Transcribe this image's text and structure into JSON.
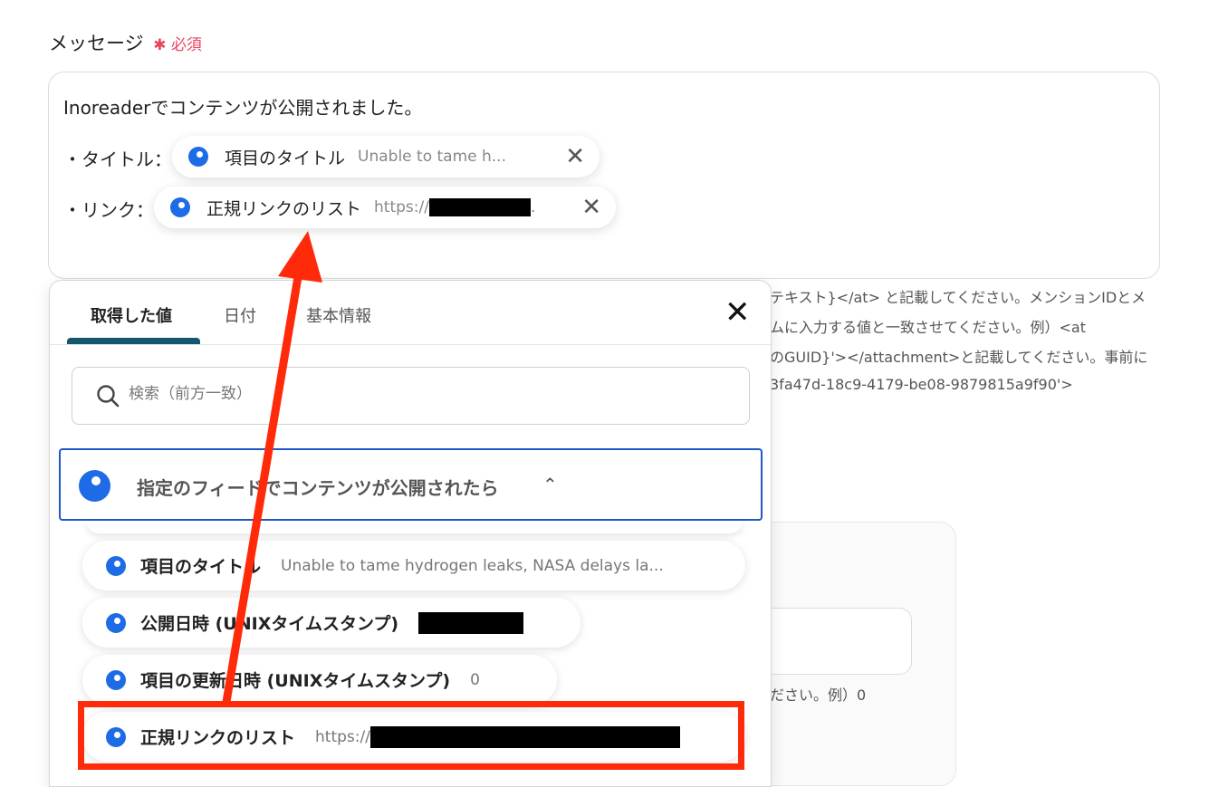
{
  "field": {
    "label": "メッセージ",
    "required_mark": "✱",
    "required_label": "必須"
  },
  "editor": {
    "line1": "Inoreaderでコンテンツが公開されました。",
    "title_row_label": "・タイトル：",
    "link_row_label": "・リンク：",
    "title_chip": {
      "name": "項目のタイトル",
      "value": "Unable to tame h..."
    },
    "link_chip": {
      "name": "正規リンクのリスト",
      "value_prefix": "https://",
      "value_suffix": "."
    }
  },
  "help_text": [
    "テキスト}</at> と記載してください。メンションIDとメ",
    "ムに入力する値と一致させてください。例）<at",
    "のGUID}'></attachment>と記載してください。事前に",
    "3fa47d-18c9-4179-be08-9879815a9f90'>"
  ],
  "background_text": "ださい。例）0",
  "popup": {
    "tabs": [
      "取得した値",
      "日付",
      "基本情報"
    ],
    "search_placeholder": "検索（前方一致）",
    "group_title": "指定のフィードでコンテンツが公開されたら",
    "items": [
      {
        "name": "項目のタイトル",
        "value": "Unable to tame hydrogen leaks, NASA delays la..."
      },
      {
        "name": "公開日時 (UNIXタイムスタンプ)",
        "value": ""
      },
      {
        "name": "項目の更新日時 (UNIXタイムスタンプ)",
        "value": "0"
      },
      {
        "name": "正規リンクのリスト",
        "value": "https://"
      }
    ]
  },
  "colors": {
    "accent_blue": "#1e6be6",
    "required_red": "#e8455f",
    "annotation_red": "#ff2a0a",
    "tab_underline": "#14566e"
  }
}
